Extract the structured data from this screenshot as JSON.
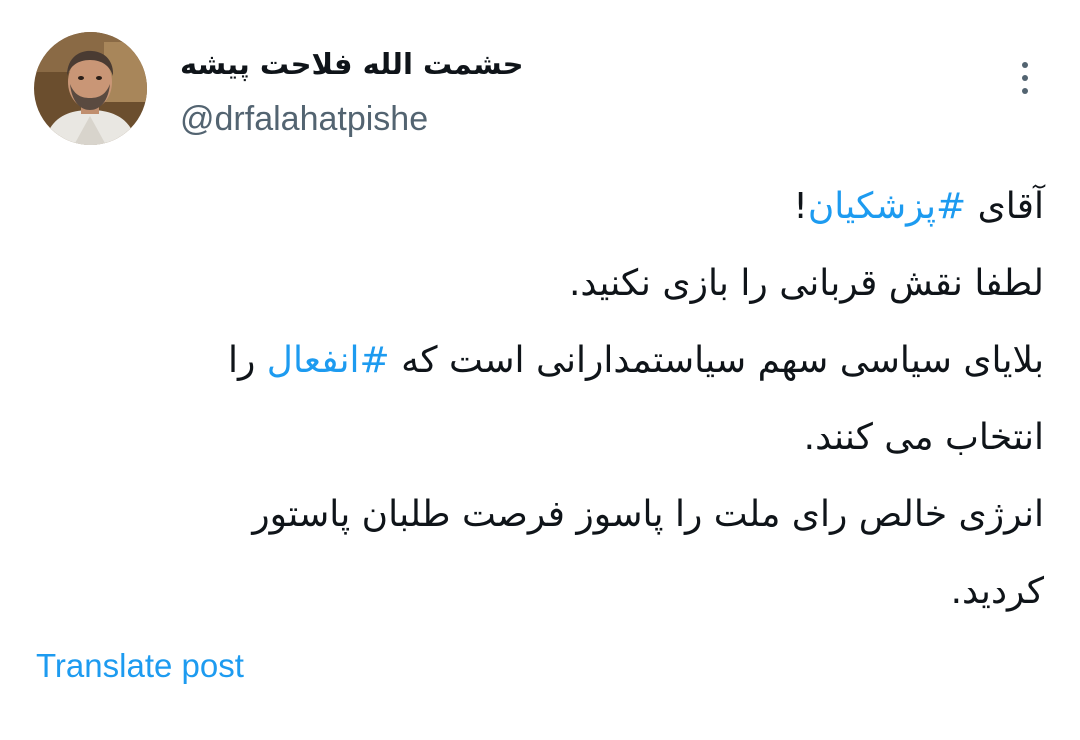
{
  "author": {
    "display_name": "حشمت الله فلاحت پیشه",
    "handle": "@drfalahatpishe",
    "avatar_icon": "profile-photo"
  },
  "menu": {
    "icon": "more-vertical-icon"
  },
  "tweet": {
    "line1": {
      "pre": "آقای ",
      "hashtag": "#پزشکیان",
      "post": "!"
    },
    "line2": "لطفا نقش قربانی را بازی نکنید.",
    "line3": {
      "pre": "بلایای سیاسی سهم سیاستمدارانی است که ",
      "hashtag": "#انفعال",
      "post": " را"
    },
    "line4": "انتخاب می کنند.",
    "line5": "انرژی خالص رای ملت را  پاسوز فرصت طلبان پاستور",
    "line6": "کردید."
  },
  "actions": {
    "translate_label": "Translate post"
  },
  "colors": {
    "link": "#1d9bf0",
    "secondary_text": "#536471",
    "primary_text": "#0f1419"
  }
}
